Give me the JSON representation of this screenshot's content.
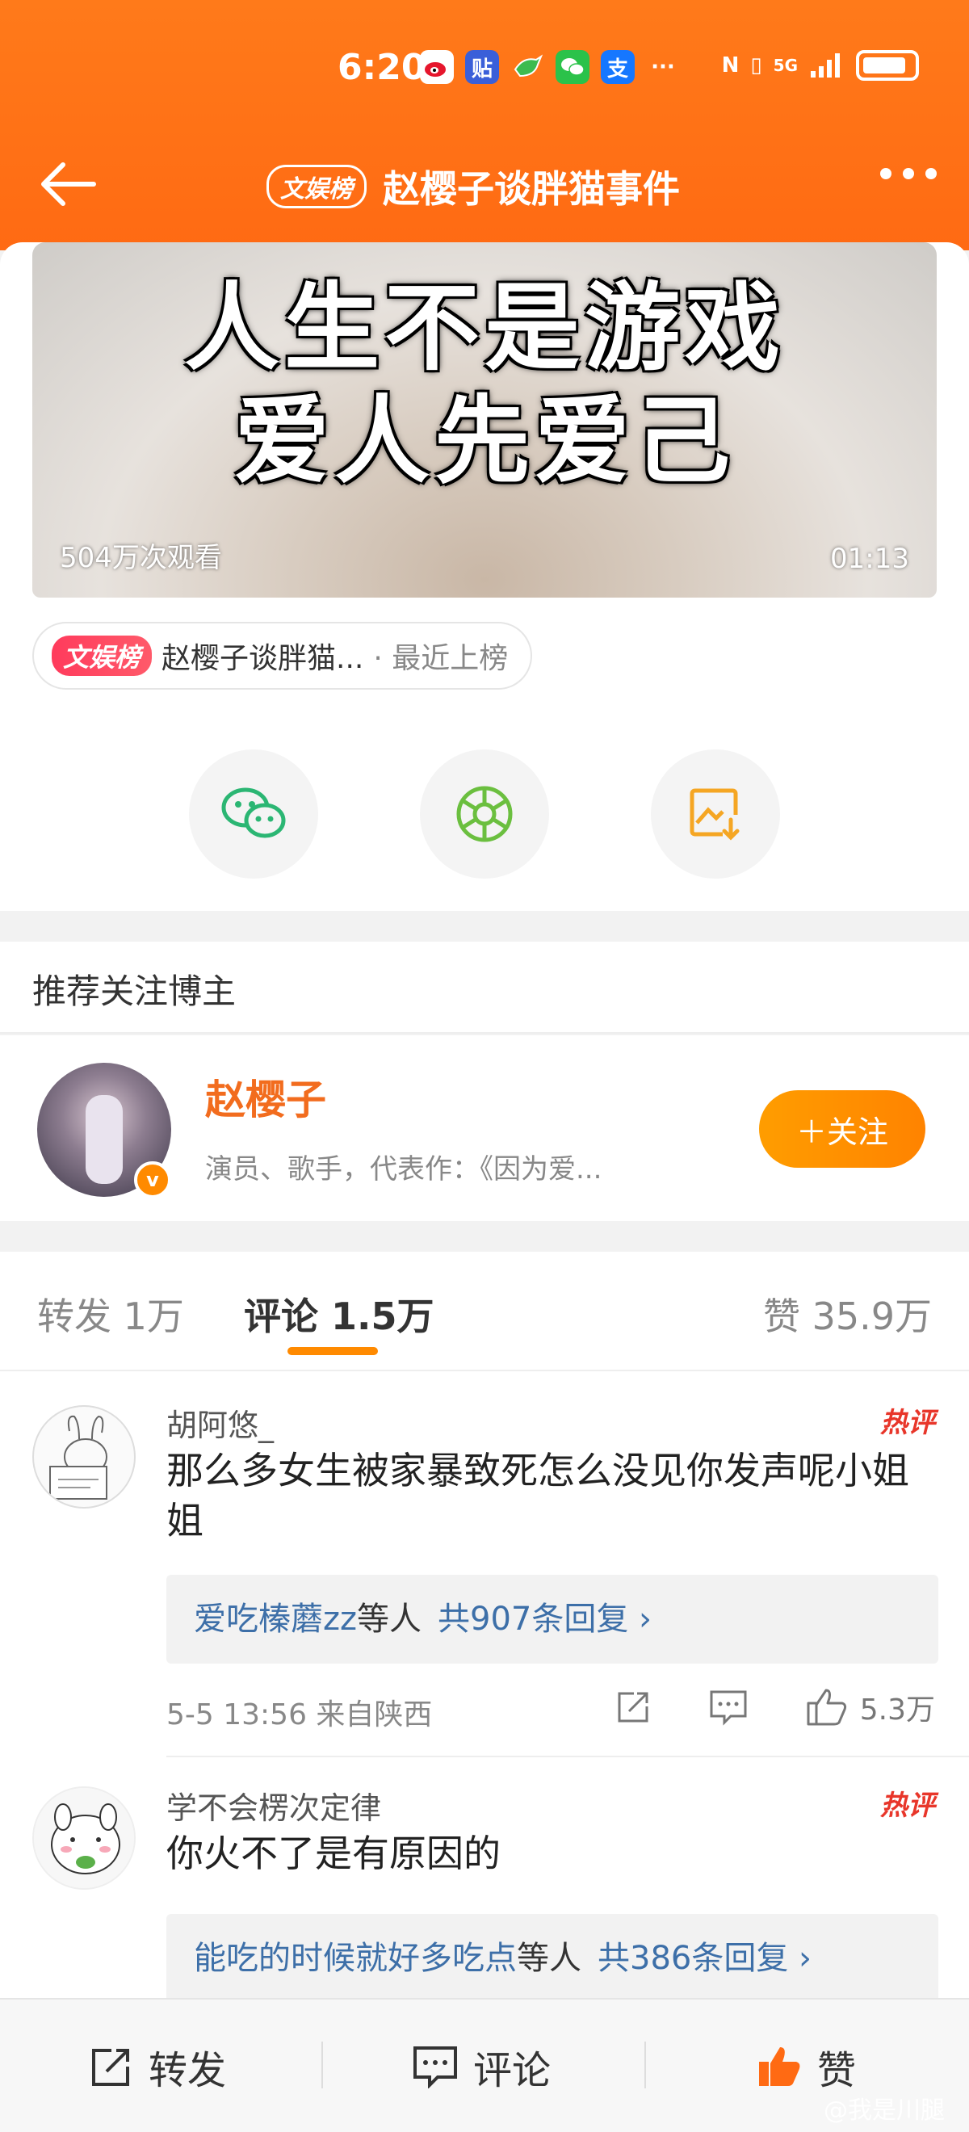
{
  "status": {
    "time": "6:20",
    "apps": [
      "weibo",
      "tieba",
      "bird",
      "wechat",
      "alipay"
    ],
    "more": "···",
    "network": "5G"
  },
  "nav": {
    "tag": "文娱榜",
    "title": "赵樱子谈胖猫事件"
  },
  "video": {
    "overlay_line1": "人生不是游戏",
    "overlay_line2": "爱人先爱己",
    "views": "504万次观看",
    "duration": "01:13"
  },
  "topic": {
    "tag": "文娱榜",
    "name": "赵樱子谈胖猫...",
    "sub": "· 最近上榜"
  },
  "share": [
    "wechat-icon",
    "moments-icon",
    "save-image-icon"
  ],
  "recommend": {
    "heading": "推荐关注博主",
    "name": "赵樱子",
    "desc": "演员、歌手，代表作：《因为爱...",
    "follow": "＋关注"
  },
  "tabs": {
    "repost": "转发 1万",
    "comment": "评论 1.5万",
    "like": "赞 35.9万"
  },
  "comments": [
    {
      "name": "胡阿悠_",
      "hot": "热评",
      "text": "那么多女生被家暴致死怎么没见你发声呢小姐姐",
      "reply_user": "爱吃榛蘑zz",
      "reply_mid": "等人",
      "reply_count": "共907条回复 ›",
      "time": "5-5 13:56 来自陕西",
      "likes": "5.3万"
    },
    {
      "name": "学不会楞次定律",
      "hot": "热评",
      "text": "你火不了是有原因的",
      "reply_user": "能吃的时候就好多吃点",
      "reply_mid": "等人",
      "reply_count": "共386条回复 ›"
    }
  ],
  "bottom": {
    "repost": "转发",
    "comment": "评论",
    "like": "赞",
    "watermark": "@我是川腿"
  },
  "colors": {
    "brand_orange": "#ff7a1a",
    "link_blue": "#3d6fa8",
    "hot_red": "#e8362a"
  }
}
